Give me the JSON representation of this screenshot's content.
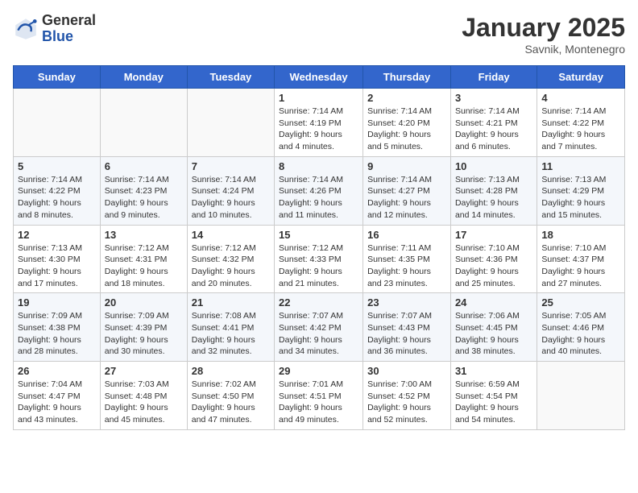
{
  "header": {
    "logo_general": "General",
    "logo_blue": "Blue",
    "month": "January 2025",
    "location": "Savnik, Montenegro"
  },
  "days_of_week": [
    "Sunday",
    "Monday",
    "Tuesday",
    "Wednesday",
    "Thursday",
    "Friday",
    "Saturday"
  ],
  "weeks": [
    [
      {
        "day": "",
        "content": ""
      },
      {
        "day": "",
        "content": ""
      },
      {
        "day": "",
        "content": ""
      },
      {
        "day": "1",
        "content": "Sunrise: 7:14 AM\nSunset: 4:19 PM\nDaylight: 9 hours and 4 minutes."
      },
      {
        "day": "2",
        "content": "Sunrise: 7:14 AM\nSunset: 4:20 PM\nDaylight: 9 hours and 5 minutes."
      },
      {
        "day": "3",
        "content": "Sunrise: 7:14 AM\nSunset: 4:21 PM\nDaylight: 9 hours and 6 minutes."
      },
      {
        "day": "4",
        "content": "Sunrise: 7:14 AM\nSunset: 4:22 PM\nDaylight: 9 hours and 7 minutes."
      }
    ],
    [
      {
        "day": "5",
        "content": "Sunrise: 7:14 AM\nSunset: 4:22 PM\nDaylight: 9 hours and 8 minutes."
      },
      {
        "day": "6",
        "content": "Sunrise: 7:14 AM\nSunset: 4:23 PM\nDaylight: 9 hours and 9 minutes."
      },
      {
        "day": "7",
        "content": "Sunrise: 7:14 AM\nSunset: 4:24 PM\nDaylight: 9 hours and 10 minutes."
      },
      {
        "day": "8",
        "content": "Sunrise: 7:14 AM\nSunset: 4:26 PM\nDaylight: 9 hours and 11 minutes."
      },
      {
        "day": "9",
        "content": "Sunrise: 7:14 AM\nSunset: 4:27 PM\nDaylight: 9 hours and 12 minutes."
      },
      {
        "day": "10",
        "content": "Sunrise: 7:13 AM\nSunset: 4:28 PM\nDaylight: 9 hours and 14 minutes."
      },
      {
        "day": "11",
        "content": "Sunrise: 7:13 AM\nSunset: 4:29 PM\nDaylight: 9 hours and 15 minutes."
      }
    ],
    [
      {
        "day": "12",
        "content": "Sunrise: 7:13 AM\nSunset: 4:30 PM\nDaylight: 9 hours and 17 minutes."
      },
      {
        "day": "13",
        "content": "Sunrise: 7:12 AM\nSunset: 4:31 PM\nDaylight: 9 hours and 18 minutes."
      },
      {
        "day": "14",
        "content": "Sunrise: 7:12 AM\nSunset: 4:32 PM\nDaylight: 9 hours and 20 minutes."
      },
      {
        "day": "15",
        "content": "Sunrise: 7:12 AM\nSunset: 4:33 PM\nDaylight: 9 hours and 21 minutes."
      },
      {
        "day": "16",
        "content": "Sunrise: 7:11 AM\nSunset: 4:35 PM\nDaylight: 9 hours and 23 minutes."
      },
      {
        "day": "17",
        "content": "Sunrise: 7:10 AM\nSunset: 4:36 PM\nDaylight: 9 hours and 25 minutes."
      },
      {
        "day": "18",
        "content": "Sunrise: 7:10 AM\nSunset: 4:37 PM\nDaylight: 9 hours and 27 minutes."
      }
    ],
    [
      {
        "day": "19",
        "content": "Sunrise: 7:09 AM\nSunset: 4:38 PM\nDaylight: 9 hours and 28 minutes."
      },
      {
        "day": "20",
        "content": "Sunrise: 7:09 AM\nSunset: 4:39 PM\nDaylight: 9 hours and 30 minutes."
      },
      {
        "day": "21",
        "content": "Sunrise: 7:08 AM\nSunset: 4:41 PM\nDaylight: 9 hours and 32 minutes."
      },
      {
        "day": "22",
        "content": "Sunrise: 7:07 AM\nSunset: 4:42 PM\nDaylight: 9 hours and 34 minutes."
      },
      {
        "day": "23",
        "content": "Sunrise: 7:07 AM\nSunset: 4:43 PM\nDaylight: 9 hours and 36 minutes."
      },
      {
        "day": "24",
        "content": "Sunrise: 7:06 AM\nSunset: 4:45 PM\nDaylight: 9 hours and 38 minutes."
      },
      {
        "day": "25",
        "content": "Sunrise: 7:05 AM\nSunset: 4:46 PM\nDaylight: 9 hours and 40 minutes."
      }
    ],
    [
      {
        "day": "26",
        "content": "Sunrise: 7:04 AM\nSunset: 4:47 PM\nDaylight: 9 hours and 43 minutes."
      },
      {
        "day": "27",
        "content": "Sunrise: 7:03 AM\nSunset: 4:48 PM\nDaylight: 9 hours and 45 minutes."
      },
      {
        "day": "28",
        "content": "Sunrise: 7:02 AM\nSunset: 4:50 PM\nDaylight: 9 hours and 47 minutes."
      },
      {
        "day": "29",
        "content": "Sunrise: 7:01 AM\nSunset: 4:51 PM\nDaylight: 9 hours and 49 minutes."
      },
      {
        "day": "30",
        "content": "Sunrise: 7:00 AM\nSunset: 4:52 PM\nDaylight: 9 hours and 52 minutes."
      },
      {
        "day": "31",
        "content": "Sunrise: 6:59 AM\nSunset: 4:54 PM\nDaylight: 9 hours and 54 minutes."
      },
      {
        "day": "",
        "content": ""
      }
    ]
  ]
}
